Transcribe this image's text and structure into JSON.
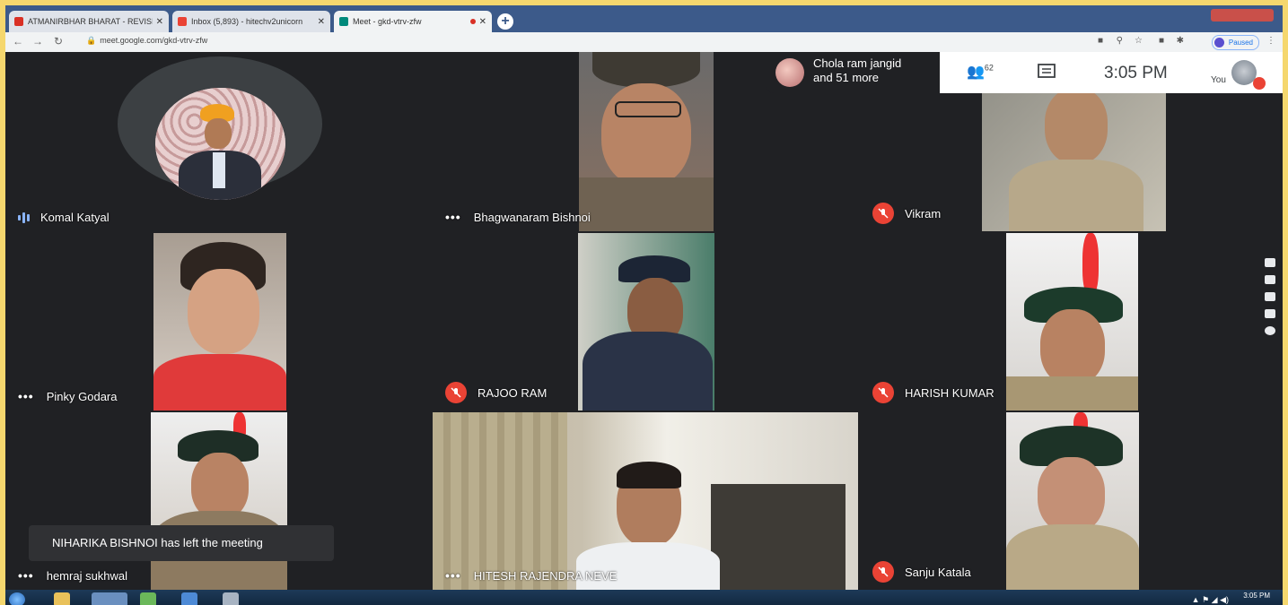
{
  "browser": {
    "tabs": [
      {
        "title": "ATMANIRBHAR BHARAT - REVISI",
        "active": false,
        "favicon_color": "#d93025"
      },
      {
        "title": "Inbox (5,893) - hitechv2unicorn",
        "active": false,
        "favicon_color": "#ea4335"
      },
      {
        "title": "Meet - gkd-vtrv-zfw",
        "active": true,
        "favicon_color": "#00897b"
      }
    ],
    "new_tab": "+",
    "url": "meet.google.com/gkd-vtrv-zfw",
    "profile_status": "Paused"
  },
  "meet": {
    "presenter_preview": {
      "name": "Chola ram jangid",
      "more": "and 51 more"
    },
    "participant_count": "62",
    "clock": "3:05 PM",
    "self_label": "You",
    "participants": [
      {
        "name": "Komal Katyal",
        "status": "speaking"
      },
      {
        "name": "Bhagwanaram Bishnoi",
        "status": "more"
      },
      {
        "name": "Vikram",
        "status": "muted"
      },
      {
        "name": "Pinky Godara",
        "status": "more"
      },
      {
        "name": "RAJOO RAM",
        "status": "muted"
      },
      {
        "name": "HARISH KUMAR",
        "status": "muted"
      },
      {
        "name": "hemraj sukhwal",
        "status": "more"
      },
      {
        "name": "HITESH RAJENDRA NEVE",
        "status": "more"
      },
      {
        "name": "Sanju Katala",
        "status": "muted"
      }
    ],
    "toast": "NIHARIKA BISHNOI has left the meeting"
  },
  "taskbar": {
    "clock_time": "3:05 PM"
  },
  "colors": {
    "meet_bg": "#202124",
    "muted_red": "#ea4335",
    "speaking_blue": "#8ab4f8",
    "border_yellow": "#f5d76e"
  }
}
